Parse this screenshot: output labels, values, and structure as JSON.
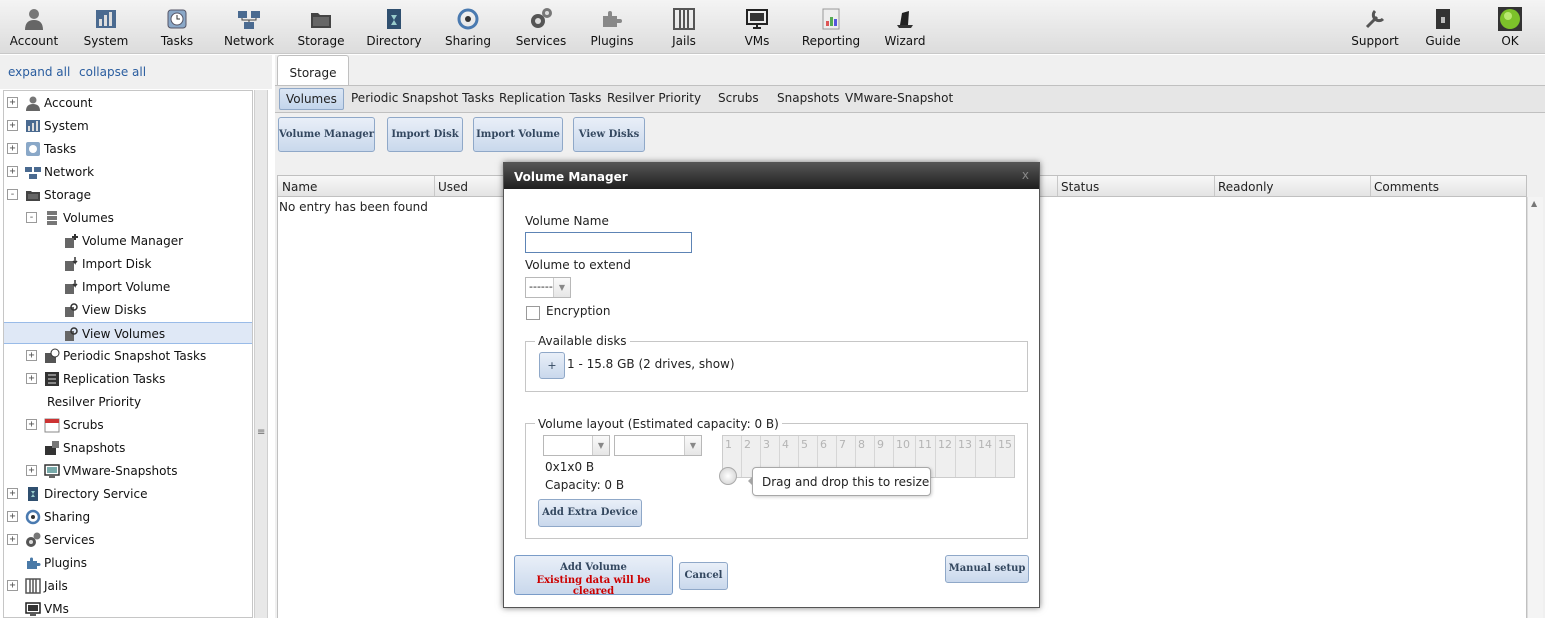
{
  "toolbar": {
    "items": [
      {
        "label": "Account",
        "icon": "account-icon"
      },
      {
        "label": "System",
        "icon": "system-icon"
      },
      {
        "label": "Tasks",
        "icon": "tasks-icon"
      },
      {
        "label": "Network",
        "icon": "network-icon"
      },
      {
        "label": "Storage",
        "icon": "storage-icon"
      },
      {
        "label": "Directory",
        "icon": "directory-icon"
      },
      {
        "label": "Sharing",
        "icon": "sharing-icon"
      },
      {
        "label": "Services",
        "icon": "services-icon"
      },
      {
        "label": "Plugins",
        "icon": "plugins-icon"
      },
      {
        "label": "Jails",
        "icon": "jails-icon"
      },
      {
        "label": "VMs",
        "icon": "vms-icon"
      },
      {
        "label": "Reporting",
        "icon": "reporting-icon"
      },
      {
        "label": "Wizard",
        "icon": "wizard-icon"
      }
    ],
    "right_items": [
      {
        "label": "Support",
        "icon": "support-icon"
      },
      {
        "label": "Guide",
        "icon": "guide-icon"
      },
      {
        "label": "OK",
        "icon": "status-ok-icon"
      }
    ]
  },
  "sidebar": {
    "expand_all": "expand all",
    "collapse_all": "collapse all",
    "tree": [
      {
        "label": "Account",
        "twisty": "+"
      },
      {
        "label": "System",
        "twisty": "+"
      },
      {
        "label": "Tasks",
        "twisty": "+"
      },
      {
        "label": "Network",
        "twisty": "+"
      },
      {
        "label": "Storage",
        "twisty": "-"
      },
      {
        "label": "Volumes",
        "twisty": "-"
      },
      {
        "label": "Volume Manager",
        "twisty": ""
      },
      {
        "label": "Import Disk",
        "twisty": ""
      },
      {
        "label": "Import Volume",
        "twisty": ""
      },
      {
        "label": "View Disks",
        "twisty": ""
      },
      {
        "label": "View Volumes",
        "twisty": ""
      },
      {
        "label": "Periodic Snapshot Tasks",
        "twisty": "+"
      },
      {
        "label": "Replication Tasks",
        "twisty": "+"
      },
      {
        "label": "Resilver Priority",
        "twisty": ""
      },
      {
        "label": "Scrubs",
        "twisty": "+"
      },
      {
        "label": "Snapshots",
        "twisty": ""
      },
      {
        "label": "VMware-Snapshots",
        "twisty": "+"
      },
      {
        "label": "Directory Service",
        "twisty": "+"
      },
      {
        "label": "Sharing",
        "twisty": "+"
      },
      {
        "label": "Services",
        "twisty": "+"
      },
      {
        "label": "Plugins",
        "twisty": ""
      },
      {
        "label": "Jails",
        "twisty": "+"
      },
      {
        "label": "VMs",
        "twisty": ""
      }
    ]
  },
  "main": {
    "tab": "Storage",
    "subtabs": [
      "Volumes",
      "Periodic Snapshot Tasks",
      "Replication Tasks",
      "Resilver Priority",
      "Scrubs",
      "Snapshots",
      "VMware-Snapshot"
    ],
    "actions": [
      "Volume Manager",
      "Import Disk",
      "Import Volume",
      "View Disks"
    ],
    "grid": {
      "columns": [
        "Name",
        "Used",
        "Status",
        "Readonly",
        "Comments"
      ],
      "empty_text": "No entry has been found"
    }
  },
  "dialog": {
    "title": "Volume Manager",
    "close": "x",
    "volume_name_label": "Volume Name",
    "volume_name_value": "",
    "volume_extend_label": "Volume to extend",
    "volume_extend_value": "------",
    "encryption_label": "Encryption",
    "available_disks_legend": "Available disks",
    "add_disk_button": "+",
    "disk_group": "1 - 15.8 GB (2 drives, show)",
    "layout_legend": "Volume layout (Estimated capacity: 0 B)",
    "layout_size": "0x1x0 B",
    "layout_capacity": "Capacity: 0 B",
    "add_extra_device": "Add Extra Device",
    "slots": [
      "1",
      "2",
      "3",
      "4",
      "5",
      "6",
      "7",
      "8",
      "9",
      "10",
      "11",
      "12",
      "13",
      "14",
      "15"
    ],
    "resize_tooltip": "Drag and drop this to resize",
    "add_volume_line1": "Add Volume",
    "add_volume_line2": "Existing data will be cleared",
    "cancel": "Cancel",
    "manual_setup": "Manual setup"
  },
  "colors": {
    "warning_text": "#cc0000",
    "button_text": "#33475f",
    "link": "#2a5d9f"
  }
}
